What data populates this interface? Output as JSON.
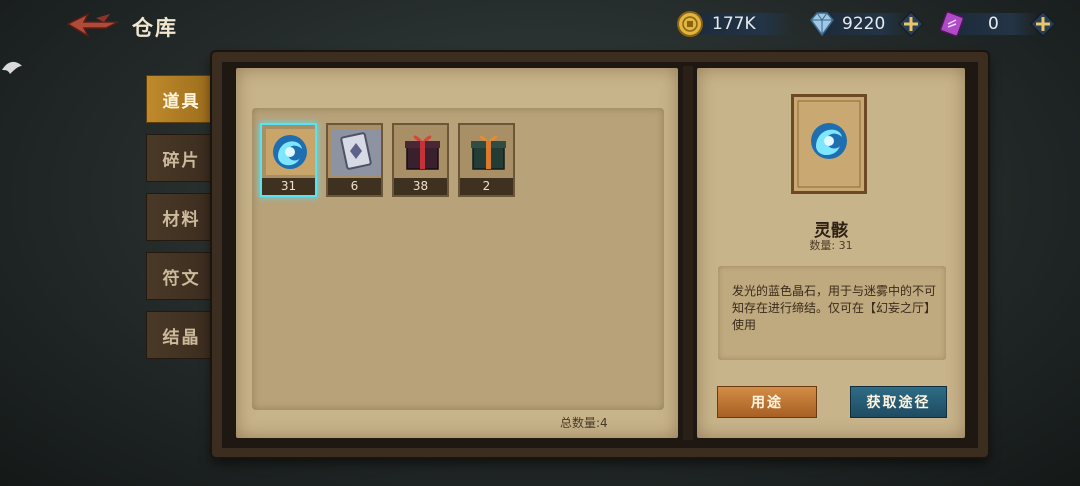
{
  "header": {
    "title": "仓库"
  },
  "currencies": [
    {
      "name": "gold-coin",
      "icon": "coin-icon",
      "value": "177K"
    },
    {
      "name": "diamond",
      "icon": "diamond-icon",
      "value": "9220"
    },
    {
      "name": "crystal-ticket",
      "icon": "crystal-ticket-icon",
      "value": "0"
    }
  ],
  "tabs": [
    {
      "label": "道具",
      "active": true
    },
    {
      "label": "碎片",
      "active": false
    },
    {
      "label": "材料",
      "active": false
    },
    {
      "label": "符文",
      "active": false
    },
    {
      "label": "结晶",
      "active": false
    }
  ],
  "inventory": {
    "items": [
      {
        "icon": "blue-spirit-orb-icon",
        "count": "31",
        "selected": true
      },
      {
        "icon": "silver-tome-icon",
        "count": "6",
        "selected": false
      },
      {
        "icon": "red-gift-box-icon",
        "count": "38",
        "selected": false
      },
      {
        "icon": "green-gift-box-icon",
        "count": "2",
        "selected": false
      }
    ],
    "total_label": "总数量:4"
  },
  "detail": {
    "name": "灵骸",
    "quantity_label": "数量: 31",
    "description": "发光的蓝色晶石，用于与迷雾中的不可知存在进行缔结。仅可在【幻妄之厅】使用",
    "use_button": "用途",
    "source_button": "获取途径"
  },
  "colors": {
    "accent_active_tab": "#c08a2b",
    "selected_slot": "#57e3f2",
    "paper": "#c8b48b"
  }
}
